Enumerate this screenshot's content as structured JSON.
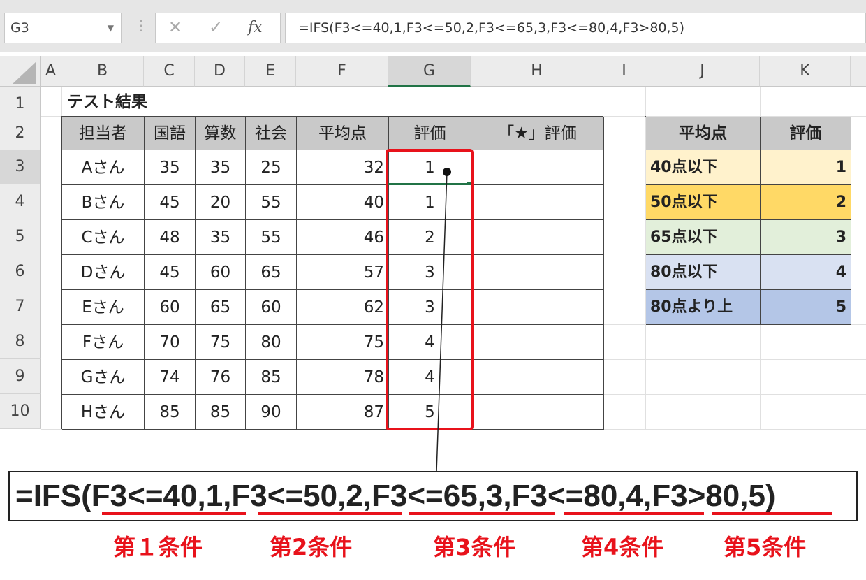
{
  "formula_bar": {
    "name_box": "G3",
    "cancel_icon": "✕",
    "enter_icon": "✓",
    "fx_label": "fx",
    "formula": "=IFS(F3<=40,1,F3<=50,2,F3<=65,3,F3<=80,4,F3>80,5)"
  },
  "columns": [
    "A",
    "B",
    "C",
    "D",
    "E",
    "F",
    "G",
    "H",
    "I",
    "J",
    "K"
  ],
  "rows": [
    "1",
    "2",
    "3",
    "4",
    "5",
    "6",
    "7",
    "8",
    "9",
    "10"
  ],
  "sheet": {
    "title": "テスト結果",
    "headers": [
      "担当者",
      "国語",
      "算数",
      "社会",
      "平均点",
      "評価",
      "「★」評価"
    ],
    "data": [
      [
        "Aさん",
        "35",
        "35",
        "25",
        "32",
        "1"
      ],
      [
        "Bさん",
        "45",
        "20",
        "55",
        "40",
        "1"
      ],
      [
        "Cさん",
        "48",
        "35",
        "55",
        "46",
        "2"
      ],
      [
        "Dさん",
        "45",
        "60",
        "65",
        "57",
        "3"
      ],
      [
        "Eさん",
        "60",
        "65",
        "60",
        "62",
        "3"
      ],
      [
        "Fさん",
        "70",
        "75",
        "80",
        "75",
        "4"
      ],
      [
        "Gさん",
        "74",
        "76",
        "85",
        "78",
        "4"
      ],
      [
        "Hさん",
        "85",
        "85",
        "90",
        "87",
        "5"
      ]
    ]
  },
  "reference_table": {
    "headers": [
      "平均点",
      "評価"
    ],
    "rows": [
      {
        "label": "40点以下",
        "value": "1",
        "color": "#fff2cc"
      },
      {
        "label": "50点以下",
        "value": "2",
        "color": "#ffd966"
      },
      {
        "label": "65点以下",
        "value": "3",
        "color": "#e2efda"
      },
      {
        "label": "80点以下",
        "value": "4",
        "color": "#d9e1f2"
      },
      {
        "label": "80点より上",
        "value": "5",
        "color": "#b4c6e7"
      }
    ]
  },
  "annotation": {
    "formula_parts": [
      "=IFS(",
      "F3<=40,1",
      ",",
      "F3<=50,2",
      ",",
      "F3<=65,3",
      ",",
      "F3<=80,4",
      ",",
      "F3>80,5",
      ")"
    ],
    "conditions": [
      "第１条件",
      "第2条件",
      "第3条件",
      "第4条件",
      "第5条件"
    ],
    "highlight_color": "#e8121b"
  }
}
